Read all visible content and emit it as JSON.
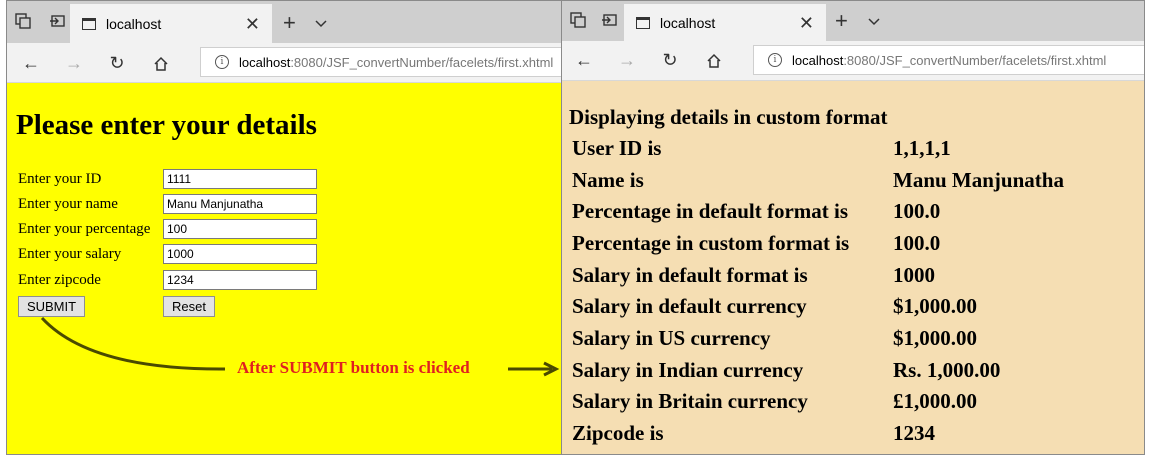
{
  "left": {
    "tab_title": "localhost",
    "url_host": "localhost",
    "url_path": ":8080/JSF_convertNumber/facelets/first.xhtml",
    "heading": "Please enter your details",
    "fields": [
      {
        "label": "Enter your ID",
        "value": "1111"
      },
      {
        "label": "Enter your name",
        "value": "Manu Manjunatha"
      },
      {
        "label": "Enter your percentage",
        "value": "100"
      },
      {
        "label": "Enter your salary",
        "value": "1000"
      },
      {
        "label": "Enter zipcode",
        "value": "1234"
      }
    ],
    "submit_label": "SUBMIT",
    "reset_label": "Reset",
    "page_color": "#ffff00"
  },
  "annotation": {
    "text": "After SUBMIT button is clicked",
    "text_color": "#e02020",
    "arrow_color": "#4a4a00"
  },
  "right": {
    "tab_title": "localhost",
    "url_host": "localhost",
    "url_path": ":8080/JSF_convertNumber/facelets/first.xhtml",
    "heading": "Displaying details in custom format",
    "rows": [
      {
        "label": "User ID is",
        "value": "1,1,1,1"
      },
      {
        "label": "Name is",
        "value": "Manu Manjunatha"
      },
      {
        "label": "Percentage in default format is",
        "value": "100.0"
      },
      {
        "label": "Percentage in custom format is",
        "value": "100.0"
      },
      {
        "label": "Salary in default format is",
        "value": "1000"
      },
      {
        "label": "Salary in default currency",
        "value": "$1,000.00"
      },
      {
        "label": "Salary in US currency",
        "value": "$1,000.00"
      },
      {
        "label": "Salary in Indian currency",
        "value": "Rs. 1,000.00"
      },
      {
        "label": "Salary in Britain currency",
        "value": "£1,000.00"
      },
      {
        "label": "Zipcode is",
        "value": "1234"
      }
    ],
    "page_color": "#f5deb3"
  },
  "icons": {
    "tab_actions": "tab-actions-icon",
    "tab_preview": "tab-preview-icon",
    "page": "page-icon",
    "close": "close-icon",
    "new_tab": "new-tab-icon",
    "tab_list": "chevron-down-icon",
    "back": "back-arrow-icon",
    "forward": "forward-arrow-icon",
    "refresh": "refresh-icon",
    "home": "home-icon",
    "info": "info-icon"
  }
}
